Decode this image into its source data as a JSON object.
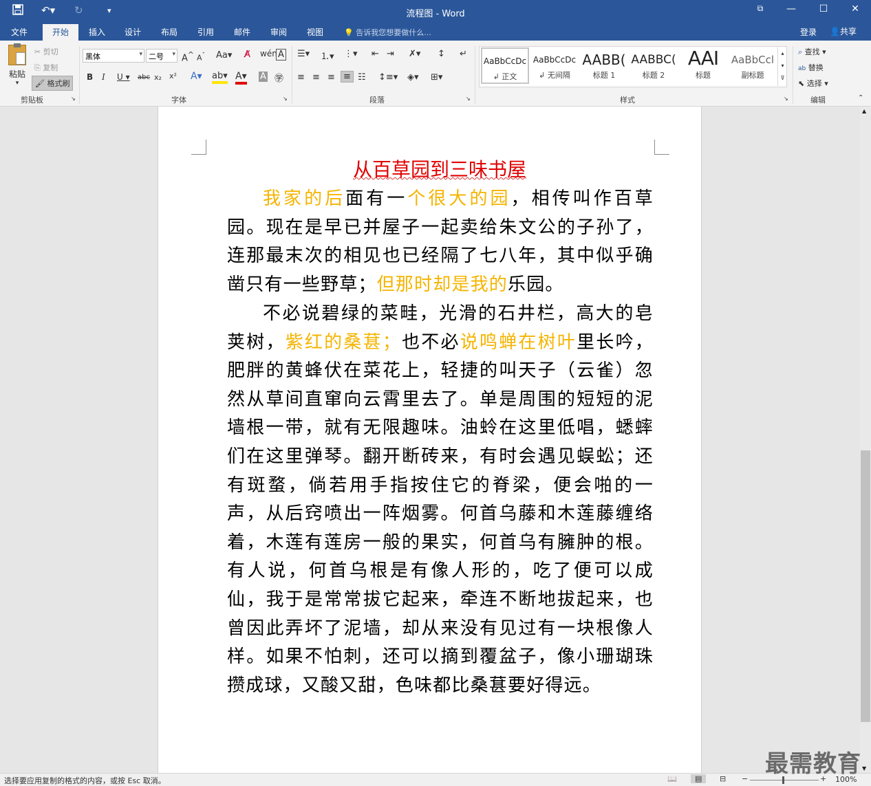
{
  "app": {
    "title": "流程图 - Word",
    "accent": "#2b579a"
  },
  "quick_access": {
    "save_icon": "save-icon",
    "undo_icon": "undo-icon",
    "redo_icon": "redo-icon",
    "customize_icon": "chevron-down-icon"
  },
  "menu": {
    "file": "文件",
    "tabs": [
      "开始",
      "插入",
      "设计",
      "布局",
      "引用",
      "邮件",
      "审阅",
      "视图"
    ],
    "tell_me": "告诉我您想要做什么...",
    "login": "登录",
    "share": "共享"
  },
  "clipboard": {
    "paste": "粘贴",
    "cut": "剪切",
    "copy": "复制",
    "format_painter": "格式刷",
    "group_label": "剪贴板"
  },
  "font": {
    "family": "黑体",
    "size": "二号",
    "group_label": "字体"
  },
  "paragraph": {
    "group_label": "段落"
  },
  "styles": {
    "items": [
      {
        "preview": "AaBbCcDc",
        "name": "正文"
      },
      {
        "preview": "AaBbCcDc",
        "name": "无间隔"
      },
      {
        "preview": "AABB(",
        "name": "标题 1"
      },
      {
        "preview": "AABBC(",
        "name": "标题 2"
      },
      {
        "preview": "AAI",
        "name": "标题"
      },
      {
        "preview": "AaBbCcl",
        "name": "副标题"
      }
    ],
    "group_label": "样式"
  },
  "editing": {
    "find": "查找",
    "replace": "替换",
    "select": "选择",
    "group_label": "编辑"
  },
  "document": {
    "heading": "从百草园到三味书屋",
    "p1": {
      "a": "我家的后",
      "b": "面有一",
      "c": "个很大的园",
      "d": "，相传叫作百草园。现在是早已并屋子一起卖给朱文公的子孙了，连那最末次的相见也已经隔了七八年，其中似乎确凿只有一些野草；",
      "e": "但那时却是我的",
      "f": "乐园。"
    },
    "p2": {
      "a": "不必说碧绿的菜畦，光滑的石井栏，高大的皂荚树，",
      "b": "紫红的桑葚；",
      "c": "也不必",
      "d": "说鸣蝉在树叶",
      "e": "里长吟，肥胖的黄蜂伏在菜花上，轻捷的叫天子（云雀）忽然从草间直窜向云霄里去了。单是周围的短短的泥墙根一带，就有无限趣味。油蛉在这里低唱，蟋蟀们在这里弹琴。翻开断砖来，有时会遇见蜈蚣；还有斑蝥，倘若用手指按住它的脊梁，便会啪的一声，从后窍喷出一阵烟雾。何首乌藤和木莲藤缠络着，木莲有莲房一般的果实，何首乌有臃肿的根。有人说，何首乌根是有像人形的，吃了便可以成仙，我于是常常拔它起来，牵连不断地拔起来，也曾因此弄坏了泥墙，却从来没有见过有一块根像人样。如果不怕刺，还可以摘到覆盆子，像小珊瑚珠攒成球，又酸又甜，色味都比桑葚要好得远。"
    },
    "heading_color": "#e00000",
    "highlight_color": "#f5b400"
  },
  "status": {
    "text": "选择要应用复制的格式的内容，或按 Esc 取消。",
    "zoom": "100%"
  },
  "watermark": "最需教育"
}
